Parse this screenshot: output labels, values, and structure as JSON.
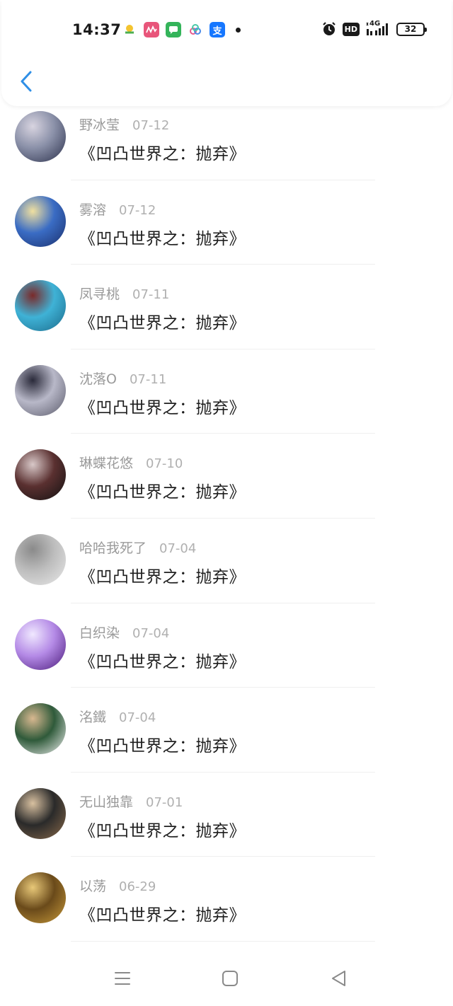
{
  "status_bar": {
    "time": "14:37",
    "notification_icons": [
      "weather-icon",
      "music-app-icon",
      "message-app-icon",
      "cloud-app-icon",
      "alipay-icon"
    ],
    "alipay_glyph": "支",
    "network": "4G",
    "hd_label": "HD",
    "battery": "32"
  },
  "header": {
    "back_icon": "back-chevron-icon"
  },
  "comments": [
    {
      "name": "野冰莹",
      "date": "07-12",
      "text": "《凹凸世界之：抛弃》",
      "avatar_colors": [
        "#2a2f4a",
        "#8a90a8",
        "#d8d4e0"
      ]
    },
    {
      "name": "雾溶",
      "date": "07-12",
      "text": "《凹凸世界之：抛弃》",
      "avatar_colors": [
        "#1b2f6b",
        "#3a6cc4",
        "#f0e0a0"
      ]
    },
    {
      "name": "凤寻桃",
      "date": "07-11",
      "text": "《凹凸世界之：抛弃》",
      "avatar_colors": [
        "#1b6a8a",
        "#3fb2d6",
        "#7a2a2a"
      ]
    },
    {
      "name": "沈落O",
      "date": "07-11",
      "text": "《凹凸世界之：抛弃》",
      "avatar_colors": [
        "#5a5a6a",
        "#b8b8c8",
        "#2a2a3a"
      ]
    },
    {
      "name": "琳蝶花悠",
      "date": "07-10",
      "text": "《凹凸世界之：抛弃》",
      "avatar_colors": [
        "#111111",
        "#5a3030",
        "#d8c8c8"
      ]
    },
    {
      "name": "哈哈我死了",
      "date": "07-04",
      "text": "《凹凸世界之：抛弃》",
      "avatar_colors": [
        "#e8e8e8",
        "#bdbdbd",
        "#8a8a8a"
      ]
    },
    {
      "name": "白织染",
      "date": "07-04",
      "text": "《凹凸世界之：抛弃》",
      "avatar_colors": [
        "#4a1a7a",
        "#b48ae6",
        "#f0e8ff"
      ]
    },
    {
      "name": "洺鐵",
      "date": "07-04",
      "text": "《凹凸世界之：抛弃》",
      "avatar_colors": [
        "#f2f2f2",
        "#2f5a3a",
        "#d8b890"
      ]
    },
    {
      "name": "无山独靠",
      "date": "07-01",
      "text": "《凹凸世界之：抛弃》",
      "avatar_colors": [
        "#8a6a4a",
        "#2a2a2a",
        "#d8c0a0"
      ]
    },
    {
      "name": "以荡",
      "date": "06-29",
      "text": "《凹凸世界之：抛弃》",
      "avatar_colors": [
        "#c89a3a",
        "#6a4a1a",
        "#e8c878"
      ]
    }
  ],
  "nav": {
    "menu": "menu-icon",
    "home": "home-icon",
    "back": "back-triangle-icon"
  }
}
